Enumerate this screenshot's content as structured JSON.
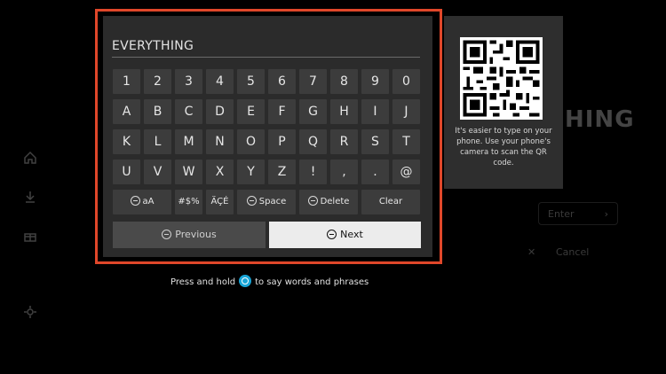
{
  "search": {
    "query": "EVERYTHING"
  },
  "keyboard": {
    "rows": [
      [
        "1",
        "2",
        "3",
        "4",
        "5",
        "6",
        "7",
        "8",
        "9",
        "0"
      ],
      [
        "A",
        "B",
        "C",
        "D",
        "E",
        "F",
        "G",
        "H",
        "I",
        "J"
      ],
      [
        "K",
        "L",
        "M",
        "N",
        "O",
        "P",
        "Q",
        "R",
        "S",
        "T"
      ],
      [
        "U",
        "V",
        "W",
        "X",
        "Y",
        "Z",
        "!",
        ",",
        ".",
        "@"
      ]
    ],
    "function_keys": {
      "case": "aA",
      "symbols": "#$%",
      "accents": "ÄÇÉ",
      "space": "Space",
      "delete": "Delete",
      "clear": "Clear"
    },
    "previous_label": "Previous",
    "next_label": "Next"
  },
  "qr_panel": {
    "text": "It's easier to type on your phone. Use your phone's camera to scan the QR code."
  },
  "hint": {
    "before": "Press and hold",
    "after": "to say words and phrases"
  },
  "background": {
    "title_fragment": "HING",
    "enter_label": "Enter",
    "cancel_label": "Cancel"
  },
  "icons": {
    "nav": [
      "home-icon",
      "download-icon",
      "gift-icon",
      "settings-icon"
    ],
    "alexa": "alexa-icon",
    "accent": "#e0472a",
    "alexa_color": "#17a4d6"
  }
}
